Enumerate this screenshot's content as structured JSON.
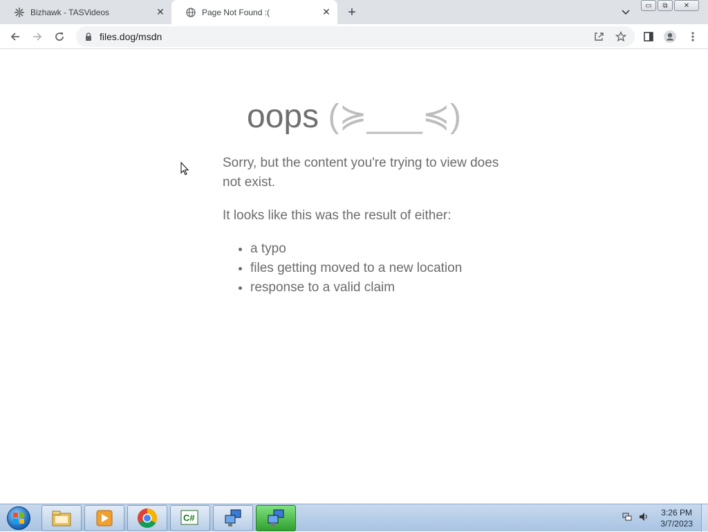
{
  "tabs": [
    {
      "title": "Bizhawk - TASVideos",
      "icon": "tasvideos-icon",
      "close": "✕"
    },
    {
      "title": "Page Not Found :(",
      "icon": "globe-icon",
      "close": "✕"
    }
  ],
  "new_tab_symbol": "+",
  "window_controls": {
    "minimize": "▭",
    "restore": "⧉",
    "close": "✕"
  },
  "toolbar": {
    "back_icon": "back-arrow-icon",
    "forward_icon": "forward-arrow-icon",
    "reload_icon": "reload-icon",
    "url": "files.dog/msdn"
  },
  "page": {
    "heading": "oops",
    "face": "(≽___≼)",
    "message": "Sorry, but the content you're trying to view does not exist.",
    "cause_intro": "It looks like this was the result of either:",
    "reasons": [
      "a typo",
      "files getting moved to a new location",
      "response to a valid claim"
    ]
  },
  "taskbar": {
    "time": "3:26 PM",
    "date": "3/7/2023",
    "apps": [
      "file-explorer",
      "media-player",
      "chrome",
      "csharp-editor",
      "network-app",
      "network-app-active"
    ]
  },
  "colors": {
    "tabstrip": "#dee1e6",
    "text_gray": "#6b6b6b",
    "face_gray": "#bdbdbd"
  }
}
